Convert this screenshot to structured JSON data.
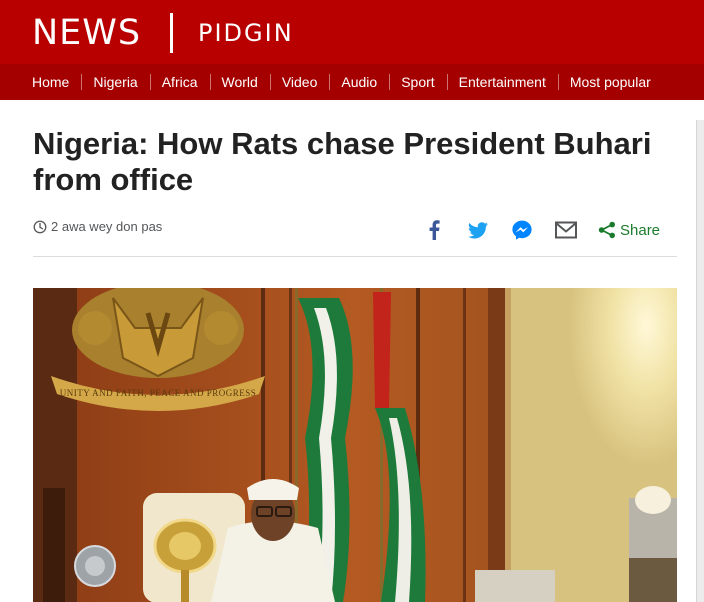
{
  "brand": {
    "news": "NEWS",
    "section": "PIDGIN"
  },
  "nav": [
    {
      "label": "Home"
    },
    {
      "label": "Nigeria"
    },
    {
      "label": "Africa"
    },
    {
      "label": "World"
    },
    {
      "label": "Video"
    },
    {
      "label": "Audio"
    },
    {
      "label": "Sport"
    },
    {
      "label": "Entertainment"
    },
    {
      "label": "Most popular"
    }
  ],
  "article": {
    "headline": "Nigeria: How Rats chase President Buhari from office",
    "timestamp": "2 awa wey don pas",
    "image_alt": "President Buhari seated at desk beside flags"
  },
  "share": {
    "label": "Share",
    "icons": [
      "facebook-icon",
      "twitter-icon",
      "messenger-icon",
      "email-icon",
      "share-icon"
    ]
  },
  "photo_text": {
    "coat_of_arms_motto": "UNITY AND FAITH, PEACE AND PROGRESS"
  },
  "colors": {
    "brand_red": "#b80000",
    "nav_red": "#a50000",
    "facebook": "#3b5998",
    "twitter": "#1da1f2",
    "messenger": "#0084ff",
    "email": "#545658",
    "share": "#1b7b2c"
  }
}
